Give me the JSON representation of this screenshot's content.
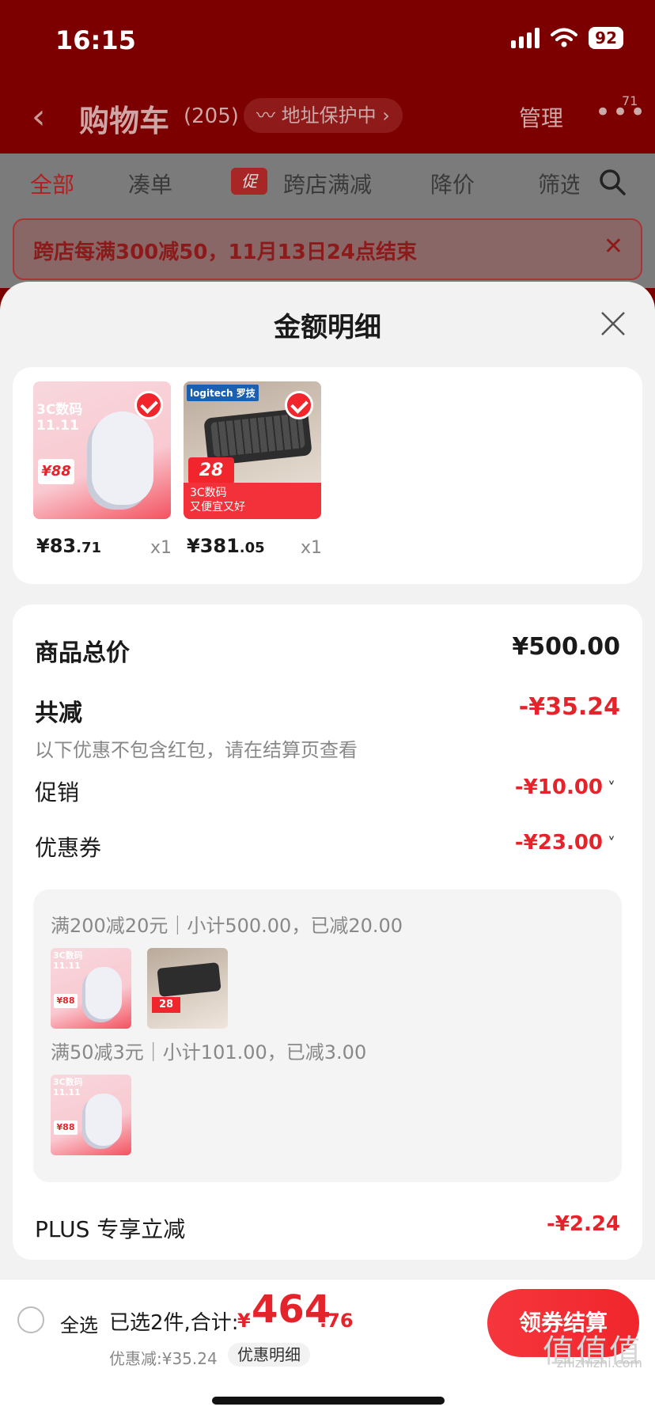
{
  "status_bar": {
    "time": "16:15",
    "battery": "92"
  },
  "nav": {
    "title": "购物车",
    "count": "(205)",
    "address_pill": "〰 地址保护中 ›",
    "manage": "管理",
    "more": "•••",
    "badge": "71"
  },
  "tabs": [
    {
      "label": "全部"
    },
    {
      "label": "凑单"
    },
    {
      "label": "跨店满减"
    },
    {
      "label": "降价"
    },
    {
      "label": "筛选"
    }
  ],
  "promo_tag": "促",
  "promo_banner": "跨店每满300减50，11月13日24点结束",
  "sheet": {
    "title": "金额明细",
    "products": [
      {
        "price_int": "¥83",
        "price_dec": ".71",
        "qty": "x1",
        "thumb_text": "3C数码\n11.11",
        "badge": "¥88"
      },
      {
        "price_int": "¥381",
        "price_dec": ".05",
        "qty": "x1",
        "thumb_text": "logitech 罗技",
        "badge": "28",
        "footer": "3C数码\n又便宜又好"
      }
    ],
    "summary": {
      "total_label": "商品总价",
      "total_value": "¥500.00",
      "reduce_label": "共减",
      "reduce_value": "-¥35.24",
      "note": "以下优惠不包含红包，请在结算页查看",
      "promo_label": "促销",
      "promo_value": "-¥10.00",
      "coupon_label": "优惠券",
      "coupon_value": "-¥23.00",
      "coupon_lines": [
        "满200减20元｜小计500.00，已减20.00",
        "满50减3元｜小计101.00，已减3.00"
      ],
      "plus_label": "PLUS 专享立减",
      "plus_value": "-¥2.24"
    }
  },
  "bottom": {
    "select_all": "全选",
    "selected": "已选2件,合计:",
    "total_symbol": "¥",
    "total_int": "464",
    "total_dec": ".76",
    "discount": "优惠减:¥35.24",
    "detail": "优惠明细",
    "checkout": "领券结算"
  },
  "watermark": {
    "big": "值值值",
    "small": "zhizhizhi.com"
  },
  "colors": {
    "brand_red": "#e5232b",
    "header_dark": "#7c0000"
  }
}
